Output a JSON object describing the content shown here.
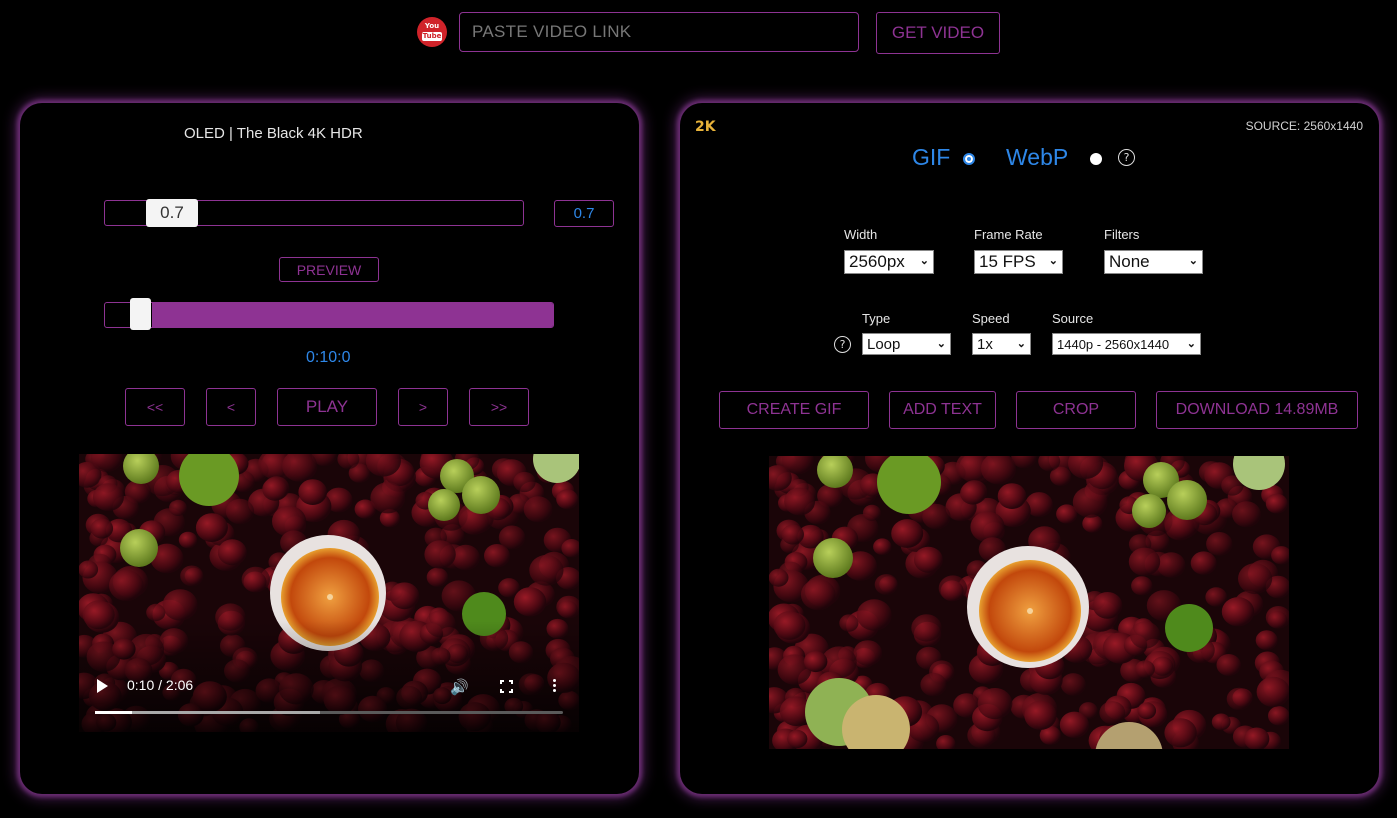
{
  "topbar": {
    "youtube_icon": "youtube-logo",
    "youtube_top": "You",
    "youtube_bottom": "Tube",
    "url_placeholder": "PASTE VIDEO LINK",
    "url_value": "",
    "get_video_label": "GET VIDEO"
  },
  "left": {
    "video_title": "OLED | The Black 4K HDR",
    "speed_value": "0.7",
    "speed_readout": "0.7",
    "preview_label": "PREVIEW",
    "time_readout": "0:10:0",
    "time_position_fraction": 0.08,
    "nav": {
      "back_far": "<<",
      "back": "<",
      "play": "PLAY",
      "forward": ">",
      "forward_far": ">>"
    },
    "player": {
      "time_display": "0:10 / 2:06",
      "progress_fraction": 0.08,
      "buffered_fraction": 0.48,
      "volume_icon": "volume-icon",
      "fullscreen_icon": "fullscreen-icon",
      "more_icon": "more-options-icon"
    }
  },
  "right": {
    "resolution_badge": "2K",
    "source_label": "SOURCE: 2560x1440",
    "formats": [
      {
        "label": "GIF",
        "selected": true
      },
      {
        "label": "WebP",
        "selected": false
      }
    ],
    "help_glyph": "?",
    "fields": {
      "width": {
        "label": "Width",
        "value": "2560px"
      },
      "frame_rate": {
        "label": "Frame Rate",
        "value": "15 FPS"
      },
      "filters": {
        "label": "Filters",
        "value": "None"
      },
      "type": {
        "label": "Type",
        "value": "Loop"
      },
      "speed": {
        "label": "Speed",
        "value": "1x"
      },
      "source": {
        "label": "Source",
        "value": "1440p - 2560x1440"
      }
    },
    "actions": {
      "create": "CREATE GIF",
      "add_text": "ADD TEXT",
      "crop": "CROP",
      "download": "DOWNLOAD 14.89MB"
    }
  },
  "colors": {
    "accent_purple": "#8e3393",
    "accent_blue": "#2e87e8",
    "badge_gold": "#e8b33a",
    "youtube_red": "#d0232a"
  }
}
